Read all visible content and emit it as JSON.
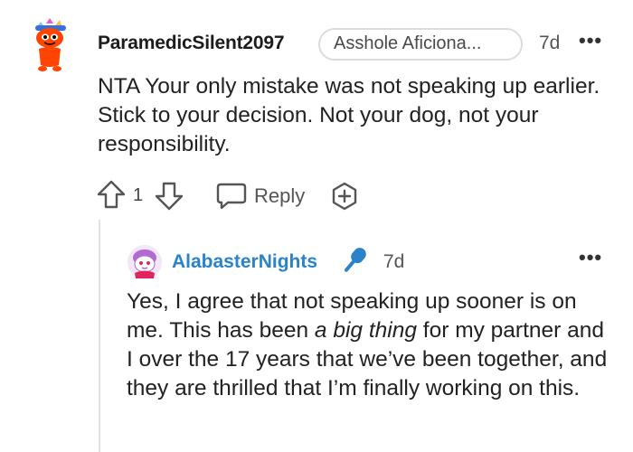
{
  "parent_comment": {
    "username": "ParamedicSilent2097",
    "flair": "Asshole Aficiona...",
    "time": "7d",
    "more_label": "•••",
    "body": "NTA Your only mistake was not speaking up earlier. Stick to your decision. Not your dog, not your responsibility.",
    "vote_count": "1",
    "reply_label": "Reply"
  },
  "reply_comment": {
    "username": "AlabasterNights",
    "time": "7d",
    "more_label": "•••",
    "body_before_em": "Yes, I agree that not speaking up sooner is on me. This has been ",
    "body_em": "a big thing",
    "body_after_em": " for my partner and I over the 17 years that we’ve been together, and they are thrilled that I’m finally working on this."
  },
  "colors": {
    "username_reply": "#2a83c9",
    "snoo_orange": "#ff4500",
    "mic_blue": "#2a83c9",
    "thread_line": "#e4e4e4"
  }
}
